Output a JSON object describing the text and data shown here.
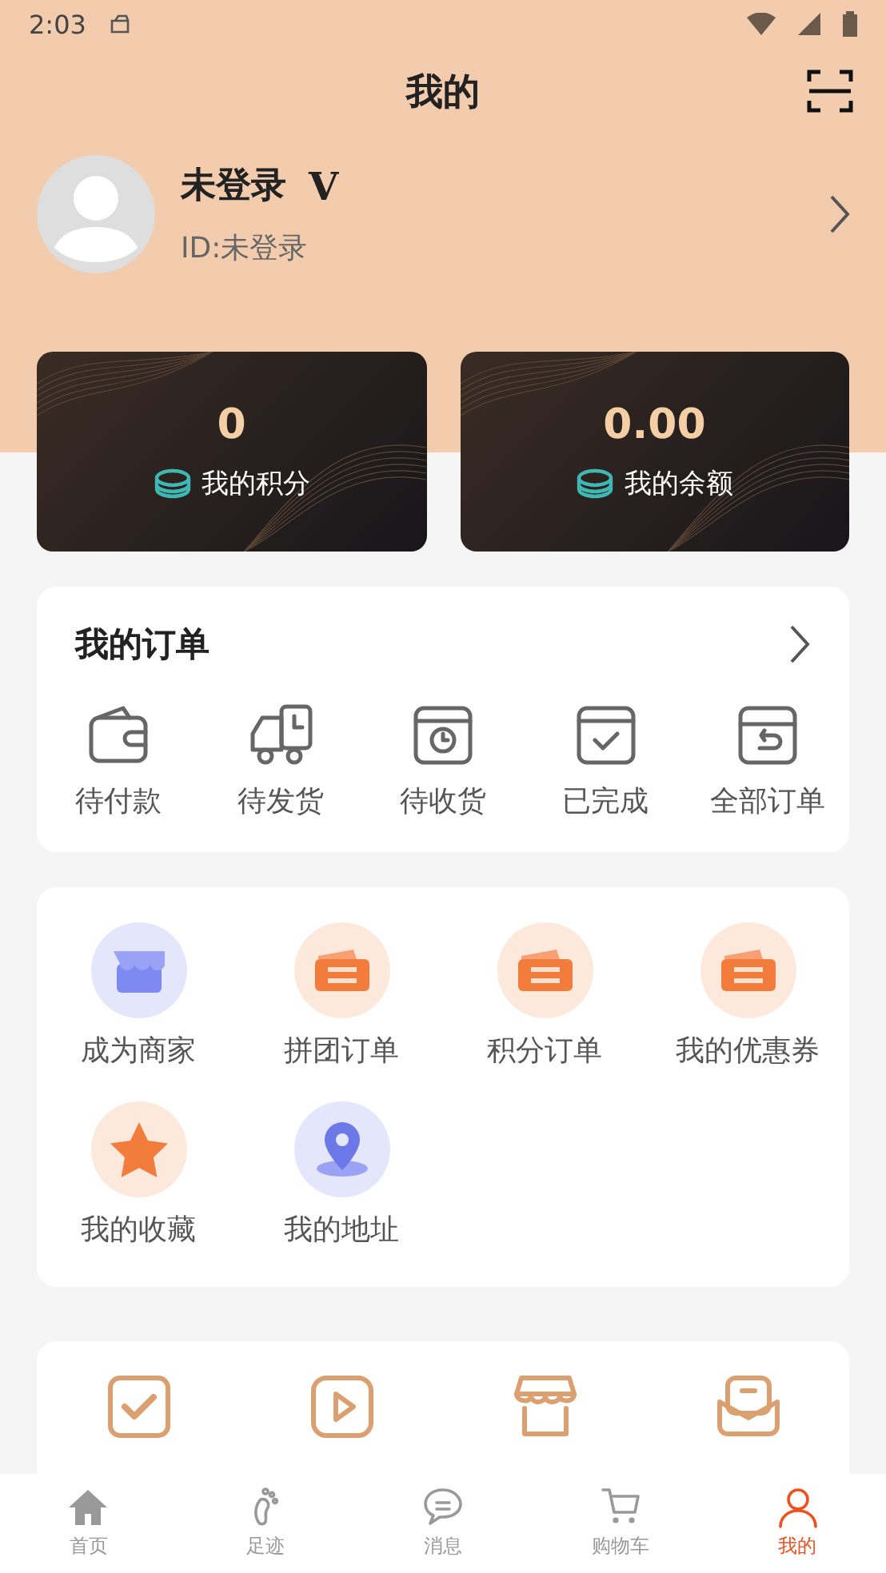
{
  "status_bar": {
    "time": "2:03"
  },
  "header": {
    "title": "我的"
  },
  "profile": {
    "name": "未登录",
    "badge": "V",
    "id": "ID:未登录"
  },
  "wallet": [
    {
      "value": "0",
      "label": "我的积分"
    },
    {
      "value": "0.00",
      "label": "我的余额"
    }
  ],
  "orders": {
    "title": "我的订单",
    "items": [
      {
        "label": "待付款",
        "kind": "wallet"
      },
      {
        "label": "待发货",
        "kind": "truck"
      },
      {
        "label": "待收货",
        "kind": "clock"
      },
      {
        "label": "已完成",
        "kind": "check"
      },
      {
        "label": "全部订单",
        "kind": "return"
      }
    ]
  },
  "services": [
    {
      "label": "成为商家",
      "kind": "store"
    },
    {
      "label": "拼团订单",
      "kind": "ticket"
    },
    {
      "label": "积分订单",
      "kind": "ticket"
    },
    {
      "label": "我的优惠券",
      "kind": "ticket"
    },
    {
      "label": "我的收藏",
      "kind": "star"
    },
    {
      "label": "我的地址",
      "kind": "pin"
    }
  ],
  "tools": [
    {
      "kind": "checkin"
    },
    {
      "kind": "video"
    },
    {
      "kind": "shop"
    },
    {
      "kind": "invite"
    }
  ],
  "tabs": [
    {
      "label": "首页",
      "kind": "home",
      "selected": false
    },
    {
      "label": "足迹",
      "kind": "foot",
      "selected": false
    },
    {
      "label": "消息",
      "kind": "chat",
      "selected": false
    },
    {
      "label": "购物车",
      "kind": "cart",
      "selected": false
    },
    {
      "label": "我的",
      "kind": "user",
      "selected": true
    }
  ]
}
